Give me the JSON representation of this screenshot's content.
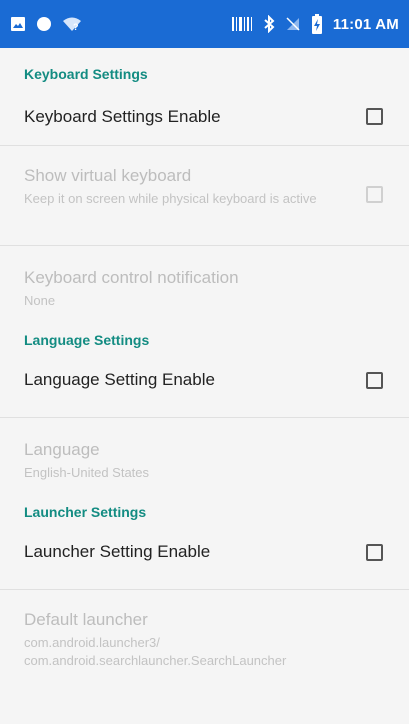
{
  "status_bar": {
    "time": "11:01 AM",
    "left_icons": [
      "image-icon",
      "circle-icon",
      "wifi-question-icon"
    ],
    "right_icons": [
      "barcode-icon",
      "bluetooth-icon",
      "no-sim-icon",
      "battery-charging-icon"
    ]
  },
  "sections": [
    {
      "header": "Keyboard Settings",
      "items": [
        {
          "title": "Keyboard Settings Enable",
          "checked": false,
          "enabled": true
        },
        {
          "title": "Show virtual keyboard",
          "summary": "Keep it on screen while physical keyboard is active",
          "checked": false,
          "enabled": false
        },
        {
          "title": "Keyboard control notification",
          "summary": "None",
          "enabled": false
        }
      ]
    },
    {
      "header": "Language Settings",
      "items": [
        {
          "title": "Language Setting Enable",
          "checked": false,
          "enabled": true
        },
        {
          "title": "Language",
          "summary": "English-United States",
          "enabled": false
        }
      ]
    },
    {
      "header": "Launcher Settings",
      "items": [
        {
          "title": "Launcher Setting Enable",
          "checked": false,
          "enabled": true
        },
        {
          "title": "Default launcher",
          "summary": "com.android.launcher3/\ncom.android.searchlauncher.SearchLauncher",
          "enabled": false
        }
      ]
    }
  ],
  "colors": {
    "status_bar": "#1a6bd4",
    "section_header": "#138c82",
    "background": "#f5f5f5"
  }
}
